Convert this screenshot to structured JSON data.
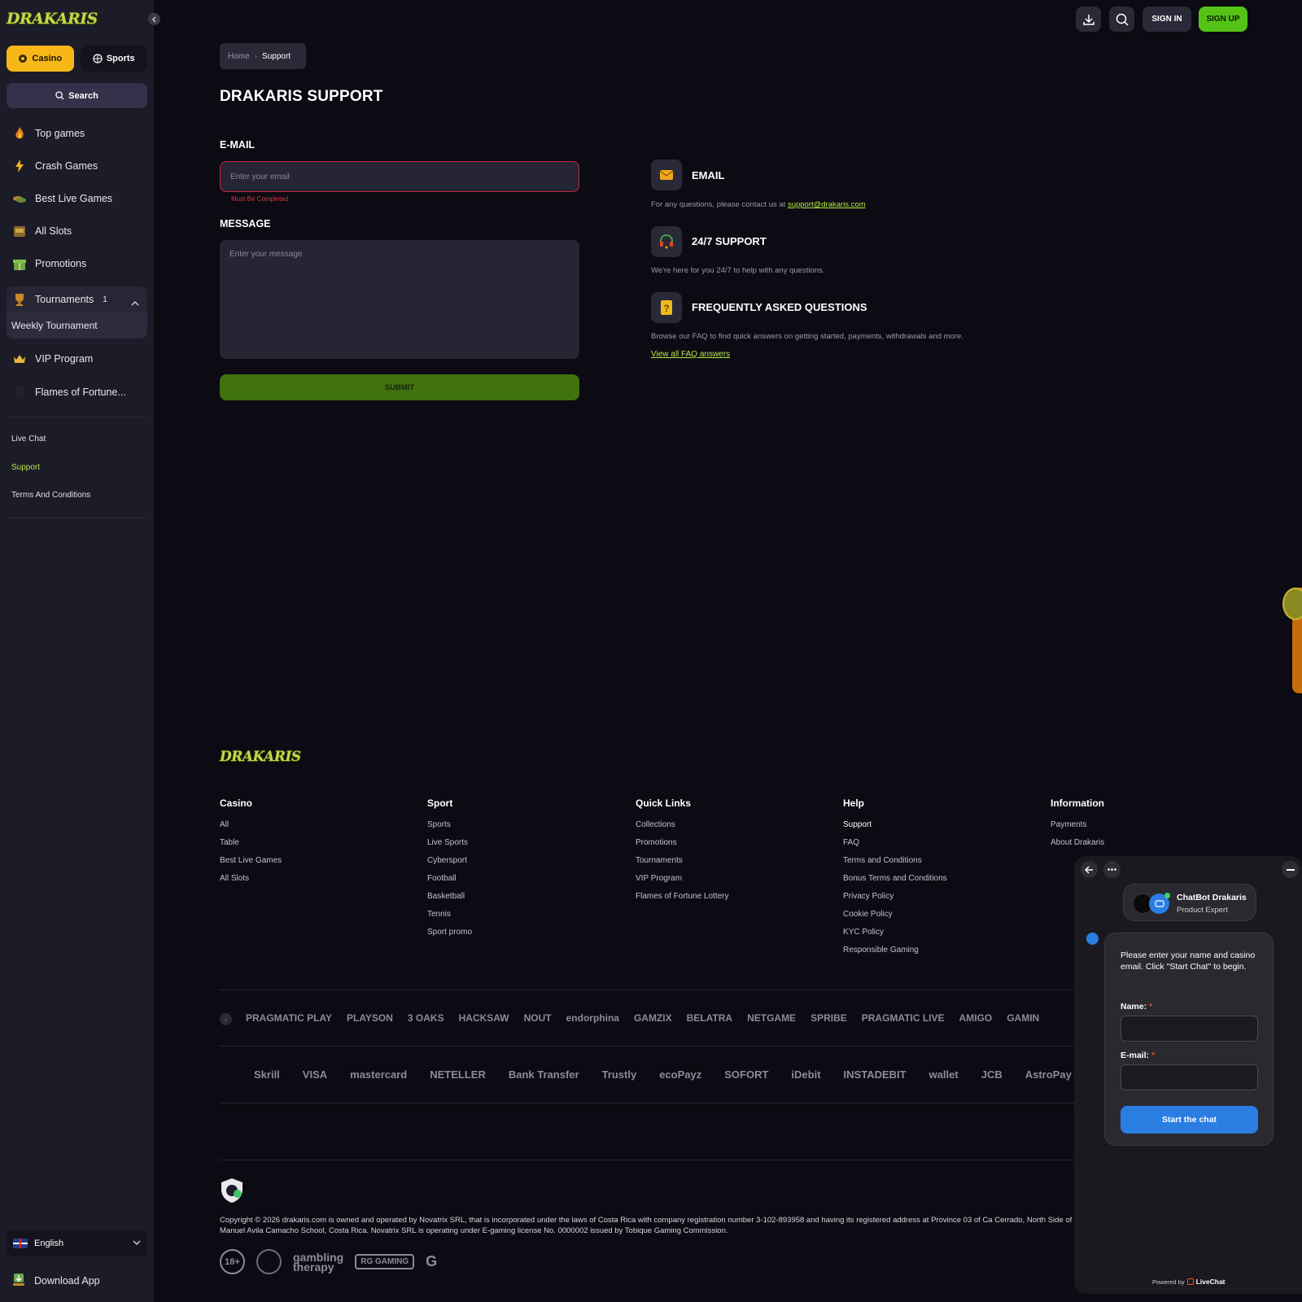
{
  "brand": {
    "logo": "DRAKARIS",
    "accent": "#55c316",
    "casino_color": "#f7b717",
    "link_color": "#b6e84a",
    "error_color": "#c6283a"
  },
  "sidebar": {
    "tabs": {
      "casino": "Casino",
      "sports": "Sports"
    },
    "search": "Search",
    "items": [
      {
        "label": "Top games",
        "icon": "fire-icon"
      },
      {
        "label": "Crash Games",
        "icon": "lightning-icon"
      },
      {
        "label": "Best Live Games",
        "icon": "chips-icon"
      },
      {
        "label": "All Slots",
        "icon": "slot-icon"
      },
      {
        "label": "Promotions",
        "icon": "gift-icon"
      }
    ],
    "tournaments": {
      "label": "Tournaments",
      "badge": "1",
      "sub": "Weekly Tournament"
    },
    "vip": "VIP Program",
    "flames": "Flames of Fortune...",
    "links": {
      "live_chat": "Live Chat",
      "support": "Support",
      "terms": "Terms And Conditions"
    },
    "language": "English",
    "download": "Download App"
  },
  "header": {
    "sign_in": "SIGN IN",
    "sign_up": "SIGN UP"
  },
  "breadcrumb": {
    "home": "Home",
    "current": "Support"
  },
  "page": {
    "title": "DRAKARIS SUPPORT",
    "email_label": "E-MAIL",
    "email_placeholder": "Enter your email",
    "email_error": "Must Be Completed",
    "message_label": "MESSAGE",
    "message_placeholder": "Enter your message",
    "submit": "SUBMIT"
  },
  "info": {
    "email_title": "EMAIL",
    "email_text": "For any questions, please contact us at",
    "email_link": "support@drakaris.com",
    "support_title": "24/7 SUPPORT",
    "support_text": "We're here for you 24/7 to help with any questions.",
    "faq_title": "FREQUENTLY ASKED QUESTIONS",
    "faq_text": "Browse our FAQ to find quick answers on getting started, payments, withdrawals and more.",
    "faq_link": "View all FAQ answers"
  },
  "footer": {
    "logo": "DRAKARIS",
    "columns": [
      {
        "title": "Casino",
        "items": [
          "All",
          "Table",
          "Best Live Games",
          "All Slots"
        ]
      },
      {
        "title": "Sport",
        "items": [
          "Sports",
          "Live Sports",
          "Cybersport",
          "Football",
          "Basketball",
          "Tennis",
          "Sport promo"
        ]
      },
      {
        "title": "Quick Links",
        "items": [
          "Collections",
          "Promotions",
          "Tournaments",
          "VIP Program",
          "Flames of Fortune Lottery"
        ]
      },
      {
        "title": "Help",
        "items": [
          "Support",
          "FAQ",
          "Terms and Conditions",
          "Bonus Terms and Conditions",
          "Privacy Policy",
          "Cookie Policy",
          "KYC Policy",
          "Responsible Gaming"
        ]
      },
      {
        "title": "Information",
        "items": [
          "Payments",
          "About Drakaris"
        ]
      }
    ],
    "providers": [
      "PRAGMATIC PLAY",
      "PLAYSON",
      "3 OAKS",
      "HACKSAW",
      "NOUT",
      "endorphina",
      "GAMZIX",
      "BELATRA",
      "NETGAME",
      "SPRIBE",
      "PRAGMATIC LIVE",
      "AMIGO",
      "GAMIN"
    ],
    "payments": [
      "Skrill",
      "VISA",
      "mastercard",
      "NETELLER",
      "Bank Transfer",
      "Trustly",
      "ecoPayz",
      "SOFORT",
      "iDebit",
      "INSTADEBIT",
      "wallet",
      "JCB",
      "AstroPay"
    ],
    "copyright": "Copyright © 2026 drakaris.com is owned and operated by Novatrix SRL, that is incorporated under the laws of Costa Rica with company registration number 3-102-893958 and having its registered address at Province 03 of Ca Cerrado, North Side of Manuel Avila Camacho School, Costa Rica. Novatrix SRL is operating under E-gaming license No. 0000002 issued by Tobique Gaming Commission.",
    "badges": {
      "age": "18+",
      "gt": [
        "gambling",
        "therapy"
      ],
      "rg": "RG GAMING",
      "gc": "G"
    }
  },
  "chat": {
    "agent_name": "ChatBot Drakaris",
    "agent_role": "Product Expert",
    "intro": "Please enter your name and casino email. Click \"Start Chat\" to begin.",
    "name_label": "Name:",
    "email_label": "E-mail:",
    "required_mark": "*",
    "start_button": "Start the chat",
    "powered_by": "Powered by",
    "powered_brand": "LiveChat"
  }
}
